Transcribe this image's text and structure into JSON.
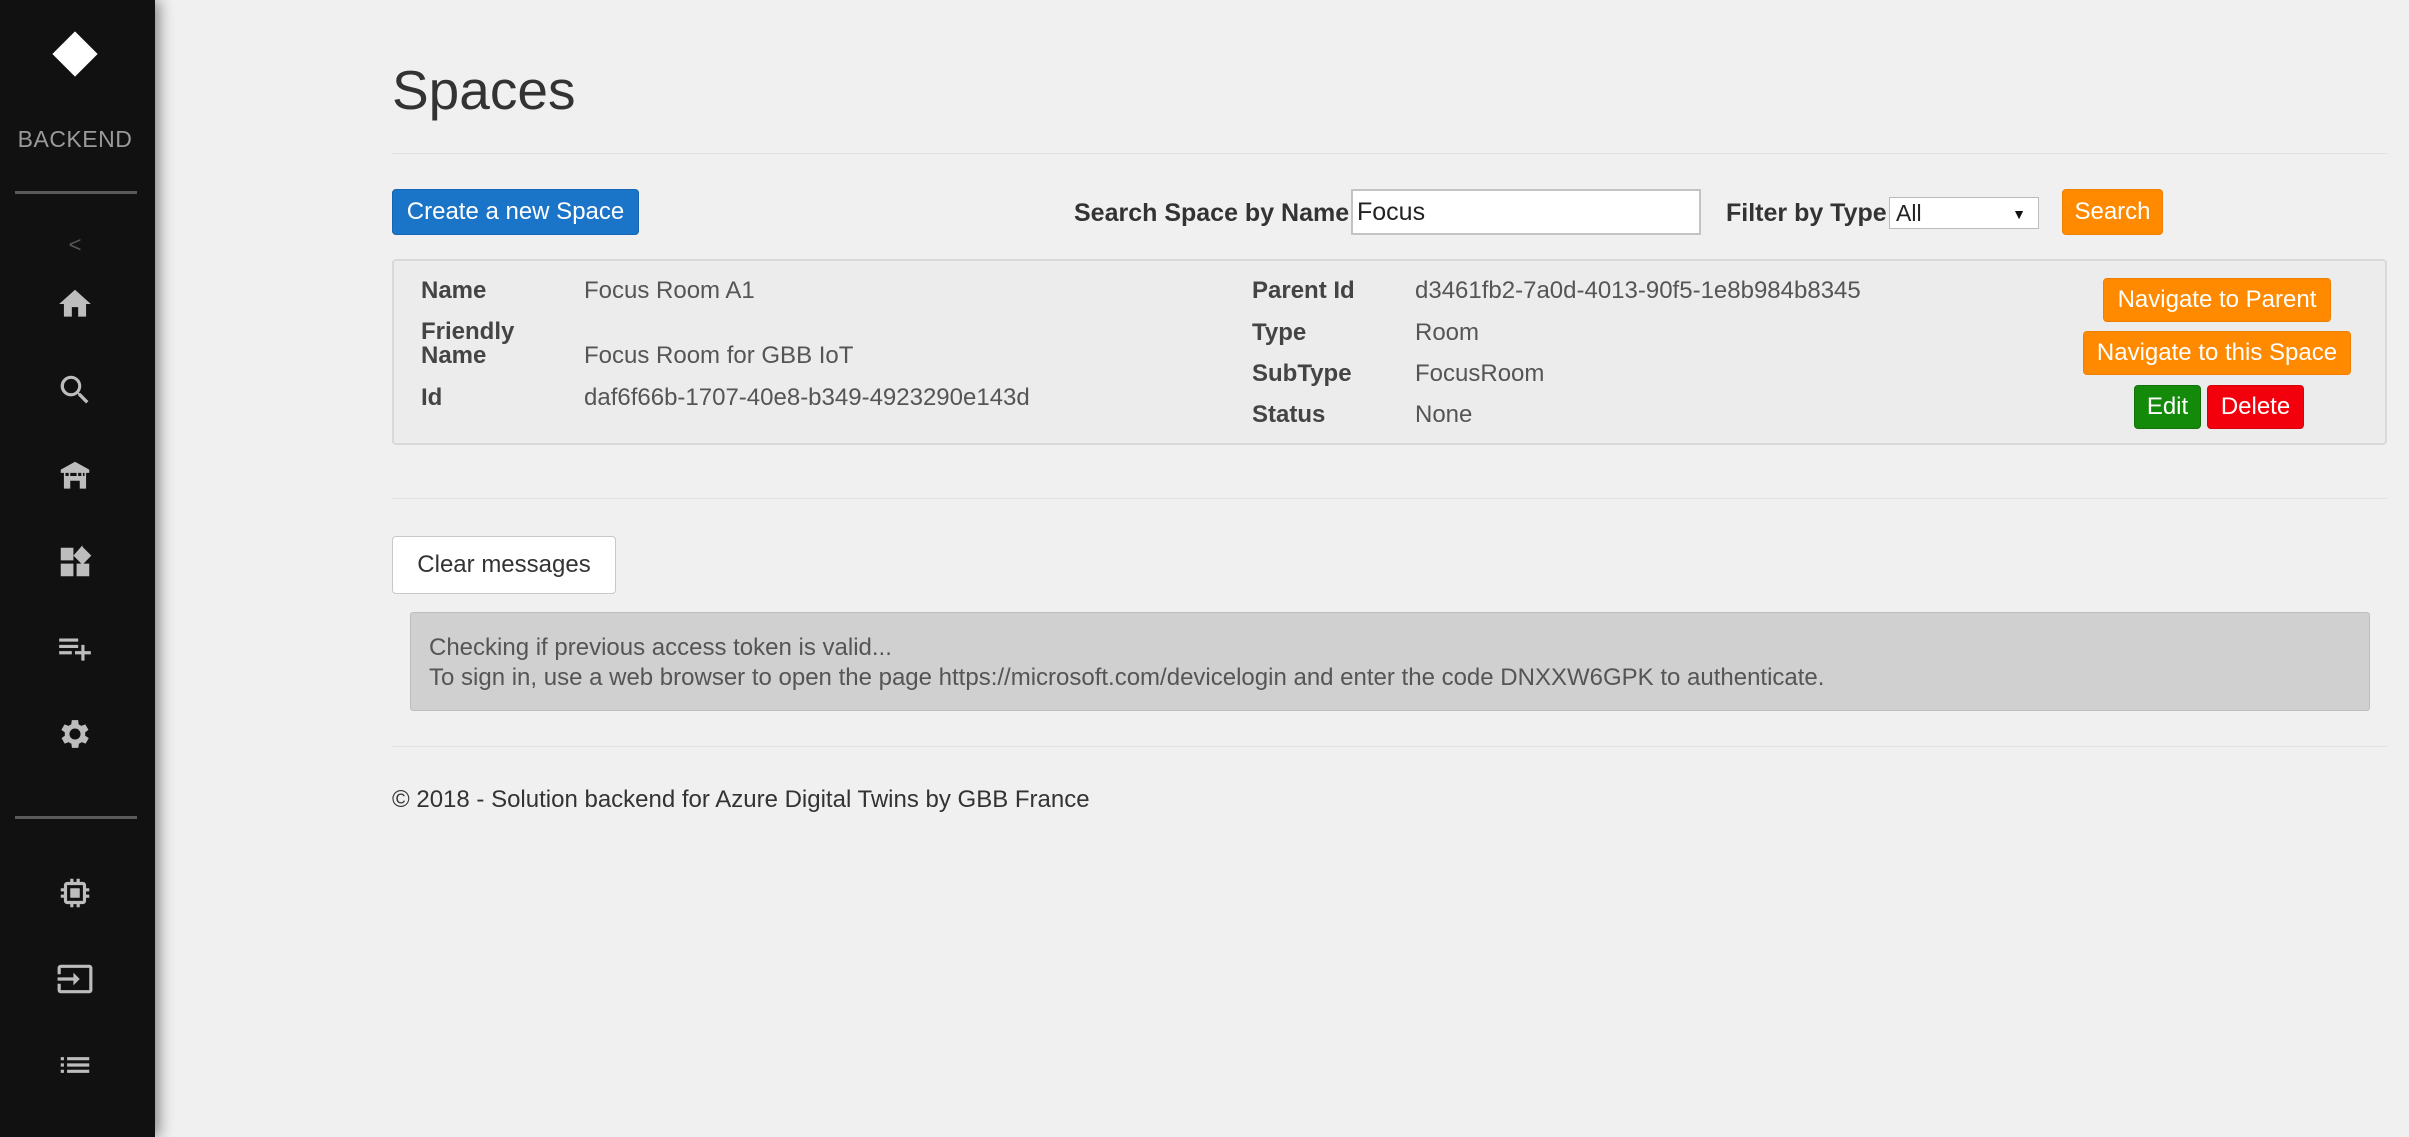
{
  "sidebar": {
    "brand": "BACKEND",
    "collapse_label": "<",
    "nav_icons": [
      "home-icon",
      "search-icon",
      "building-icon",
      "widgets-icon",
      "playlist-add-icon",
      "gear-icon"
    ],
    "bottom_icons": [
      "chip-icon",
      "sign-in-icon",
      "list-icon"
    ]
  },
  "page": {
    "title": "Spaces"
  },
  "toolbar": {
    "create_label": "Create a new Space",
    "search_label": "Search Space by Name",
    "search_value": "Focus",
    "filter_label": "Filter by Type",
    "filter_value": "All",
    "search_button": "Search"
  },
  "result": {
    "name_label": "Name",
    "name_value": "Focus Room A1",
    "friendly_label_1": "Friendly",
    "friendly_label_2": "Name",
    "friendly_value": "Focus Room for GBB IoT",
    "id_label": "Id",
    "id_value": "daf6f66b-1707-40e8-b349-4923290e143d",
    "parent_label": "Parent Id",
    "parent_value": "d3461fb2-7a0d-4013-90f5-1e8b984b8345",
    "type_label": "Type",
    "type_value": "Room",
    "subtype_label": "SubType",
    "subtype_value": "FocusRoom",
    "status_label": "Status",
    "status_value": "None",
    "nav_parent_button": "Navigate to Parent",
    "nav_space_button": "Navigate to this Space",
    "edit_button": "Edit",
    "delete_button": "Delete"
  },
  "messages": {
    "clear_button": "Clear messages",
    "line1": "Checking if previous access token is valid...",
    "line2": "To sign in, use a web browser to open the page https://microsoft.com/devicelogin and enter the code DNXXW6GPK to authenticate."
  },
  "footer": {
    "text": "© 2018 - Solution backend for Azure Digital Twins by GBB France"
  },
  "colors": {
    "sidebar_bg": "#111111",
    "primary": "#1a74c8",
    "orange": "#ff8a00",
    "green": "#138a0a",
    "red": "#f2000c",
    "page_bg": "#f0f0f0"
  }
}
